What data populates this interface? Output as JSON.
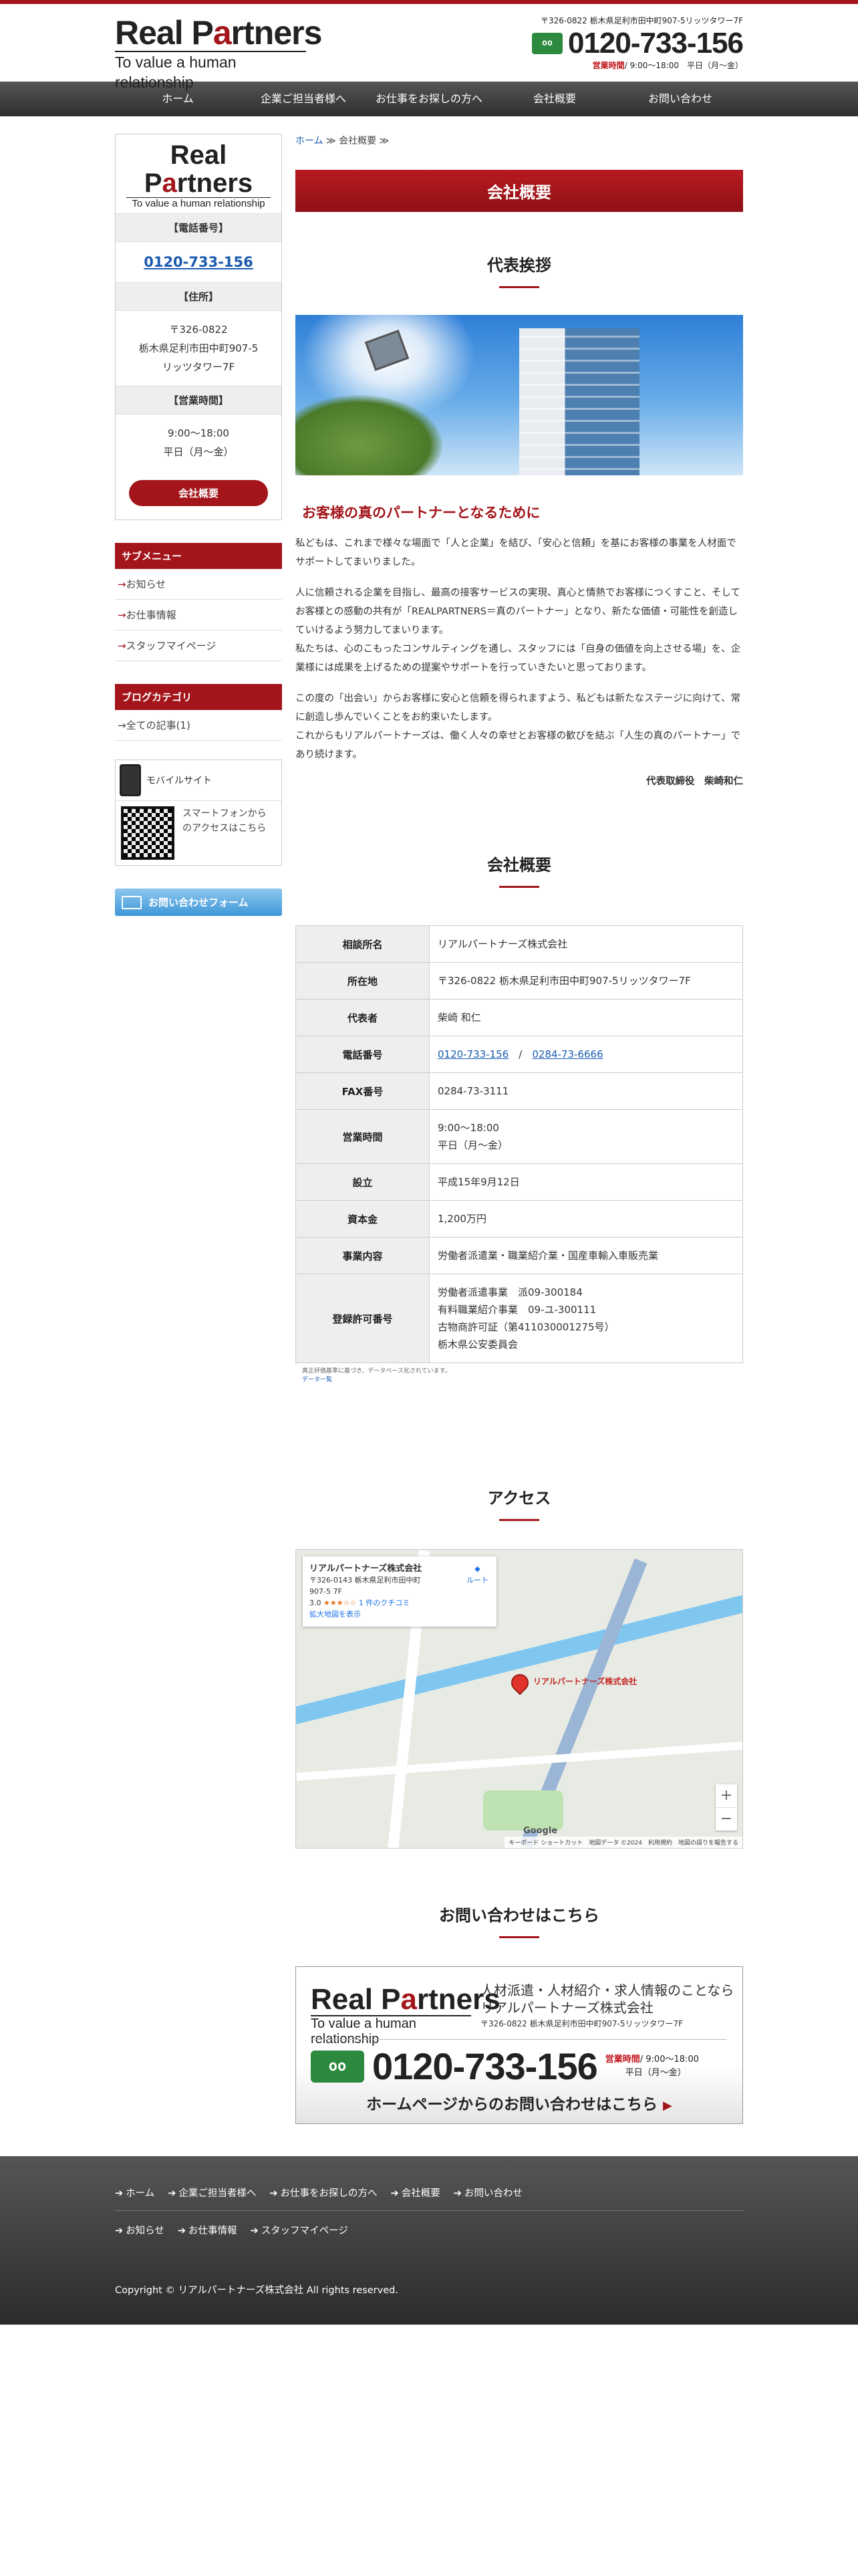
{
  "header": {
    "logo_main_a": "Real P",
    "logo_main_b": "a",
    "logo_main_c": "rtners",
    "logo_sub": "To value a human relationship",
    "address": "〒326-0822 栃木県足利市田中町907-5リッツタワー7F",
    "freedial_icon": "oo",
    "tel": "0120-733-156",
    "hours_label": "営業時間",
    "hours": "/ 9:00～18:00　平日（月～金）"
  },
  "nav": [
    "ホーム",
    "企業ご担当者様へ",
    "お仕事をお探しの方へ",
    "会社概要",
    "お問い合わせ"
  ],
  "sidebar": {
    "tel_head": "【電話番号】",
    "tel": "0120-733-156",
    "addr_head": "【住所】",
    "addr1": "〒326-0822",
    "addr2": "栃木県足利市田中町907-5",
    "addr3": "リッツタワー7F",
    "hours_head": "【営業時間】",
    "hours1": "9:00～18:00",
    "hours2": "平日（月～金）",
    "button": "会社概要",
    "submenu_title": "サブメニュー",
    "submenu": [
      "お知らせ",
      "お仕事情報",
      "スタッフマイページ"
    ],
    "blog_title": "ブログカテゴリ",
    "blog": [
      "全ての記事(1)"
    ],
    "mobile_title": "モバイルサイト",
    "mobile_text": "スマートフォンからのアクセスはこちら",
    "form_button": "お問い合わせフォーム"
  },
  "breadcrumb": {
    "home": "ホーム",
    "sep": "≫",
    "current": "会社概要",
    "sep2": "≫"
  },
  "page_title": "会社概要",
  "greeting": {
    "title": "代表挨拶",
    "heading": "お客様の真のパートナーとなるために",
    "p1": "私どもは、これまで様々な場面で「人と企業」を結び、「安心と信頼」を基にお客様の事業を人材面でサポートしてまいりました。",
    "p2a": "人に信頼される企業を目指し、最高の接客サービスの実現、真心と情熱でお客様につくすこと、そしてお客様との感動の共有が「REALPARTNERS＝真のパートナー」となり、新たな価値・可能性を創造していけるよう努力してまいります。",
    "p2b": "私たちは、心のこもったコンサルティングを通し、スタッフには「自身の価値を向上させる場」を、企業様には成果を上げるための提案やサポートを行っていきたいと思っております。",
    "p3a": "この度の「出会い」からお客様に安心と信頼を得られますよう、私どもは新たなステージに向けて、常に創造し歩んでいくことをお約束いたします。",
    "p3b": "これからもリアルパートナーズは、働く人々の幸せとお客様の歓びを結ぶ「人生の真のパートナー」であり続けます。",
    "signature": "代表取締役　柴崎和仁"
  },
  "company": {
    "title": "会社概要",
    "rows": [
      {
        "th": "相談所名",
        "td": [
          "リアルパートナーズ株式会社"
        ]
      },
      {
        "th": "所在地",
        "td": [
          "〒326-0822 栃木県足利市田中町907-5リッツタワー7F"
        ]
      },
      {
        "th": "代表者",
        "td": [
          "柴崎 和仁"
        ]
      },
      {
        "th": "FAX番号",
        "td": [
          "0284-73-3111"
        ]
      },
      {
        "th": "営業時間",
        "td": [
          "9:00～18:00",
          "平日（月～金）"
        ]
      },
      {
        "th": "設立",
        "td": [
          "平成15年9月12日"
        ]
      },
      {
        "th": "資本金",
        "td": [
          "1,200万円"
        ]
      },
      {
        "th": "事業内容",
        "td": [
          "労働者派遣業・職業紹介業・国産車輸入車販売業"
        ]
      },
      {
        "th": "登録許可番号",
        "td": [
          "労働者派遣事業　派09-300184",
          "有料職業紹介事業　09-ユ-300111",
          "古物商許可証（第411030001275号）",
          "栃木県公安委員会"
        ]
      }
    ],
    "tel_th": "電話番号",
    "tel1": "0120-733-156",
    "tel_sep": "/",
    "tel2": "0284-73-6666",
    "note": "真正評価基準に基づき、データベース化されています。",
    "note_link": "データ一覧"
  },
  "access": {
    "title": "アクセス",
    "card_name": "リアルパートナーズ株式会社",
    "card_addr": "〒326-0143 栃木県足利市田中町 907-5 7F",
    "card_rating": "3.0",
    "card_stars": "★★★☆☆",
    "card_reviews": "1 件のクチコミ",
    "card_enlarge": "拡大地図を表示",
    "card_route": "ルート",
    "pin_label": "リアルパートナーズ株式会社",
    "google": "Google",
    "footer": "キーボード ショートカット　地図データ ©2024　利用規約　地図の誤りを報告する",
    "zoom_in": "+",
    "zoom_out": "−"
  },
  "contact": {
    "title": "お問い合わせはこちら",
    "line1": "人材派遣・人材紹介・求人情報のことなら",
    "line2": "リアルパートナーズ株式会社",
    "line3": "〒326-0822 栃木県足利市田中町907-5リッツタワー7F",
    "freedial_icon": "oo",
    "tel": "0120-733-156",
    "hours_label": "営業時間",
    "hours1": "/ 9:00～18:00",
    "hours2": "平日（月～金）",
    "cta": "ホームページからのお問い合わせはこちら",
    "cta_arrow": "▶"
  },
  "footer": {
    "row1": [
      "ホーム",
      "企業ご担当者様へ",
      "お仕事をお探しの方へ",
      "会社概要",
      "お問い合わせ"
    ],
    "row2": [
      "お知らせ",
      "お仕事情報",
      "スタッフマイページ"
    ],
    "copy_prefix": "Copyright ©",
    "copy_link": "リアルパートナーズ株式会社",
    "copy_suffix": "All rights reserved."
  },
  "colors": {
    "accent": "#a3151b",
    "link": "#1a5bb0",
    "freedial": "#2c8a3e"
  }
}
